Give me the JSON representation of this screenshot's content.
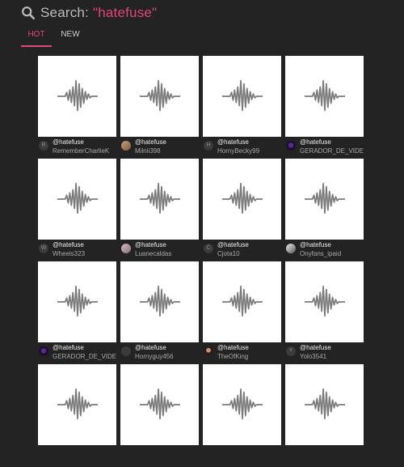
{
  "search": {
    "label": "Search:",
    "query": "\"hatefuse\""
  },
  "tabs": [
    {
      "label": "HOT",
      "active": true
    },
    {
      "label": "NEW",
      "active": false
    }
  ],
  "colors": {
    "accent": "#e0457b",
    "background": "#232323"
  },
  "icons": {
    "search": "search-icon",
    "thumbnail": "waveform-icon"
  },
  "cards": [
    {
      "handle": "@hatefuse",
      "user": "RememberCharlieK",
      "avatar_letter": "R"
    },
    {
      "handle": "@hatefuse",
      "user": "Milnii398",
      "avatar_letter": ""
    },
    {
      "handle": "@hatefuse",
      "user": "HornyBecky99",
      "avatar_letter": "H"
    },
    {
      "handle": "@hatefuse",
      "user": "GERADOR_DE_VIDEOS",
      "avatar_letter": ""
    },
    {
      "handle": "@hatefuse",
      "user": "Wheels323",
      "avatar_letter": "W"
    },
    {
      "handle": "@hatefuse",
      "user": "Luanecaldas",
      "avatar_letter": ""
    },
    {
      "handle": "@hatefuse",
      "user": "Cjota10",
      "avatar_letter": "C"
    },
    {
      "handle": "@hatefuse",
      "user": "Onyfans_ipaid",
      "avatar_letter": ""
    },
    {
      "handle": "@hatefuse",
      "user": "GERADOR_DE_VIDEOS",
      "avatar_letter": ""
    },
    {
      "handle": "@hatefuse",
      "user": "Hornyguy456",
      "avatar_letter": ""
    },
    {
      "handle": "@hatefuse",
      "user": "TheOfKing",
      "avatar_letter": ""
    },
    {
      "handle": "@hatefuse",
      "user": "Yolo3541",
      "avatar_letter": "Y"
    },
    {
      "handle": "",
      "user": "",
      "avatar_letter": ""
    },
    {
      "handle": "",
      "user": "",
      "avatar_letter": ""
    },
    {
      "handle": "",
      "user": "",
      "avatar_letter": ""
    },
    {
      "handle": "",
      "user": "",
      "avatar_letter": ""
    }
  ]
}
